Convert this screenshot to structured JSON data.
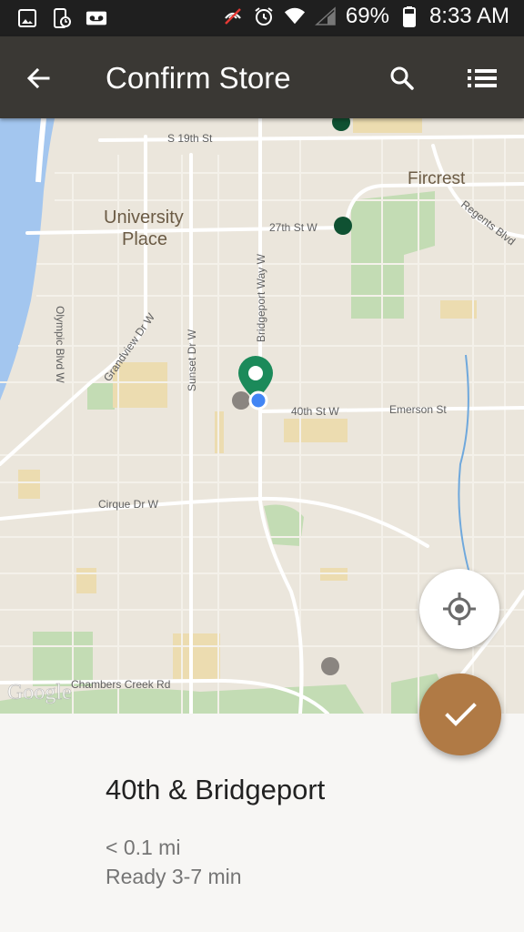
{
  "status_bar": {
    "battery_percent": "69%",
    "time": "8:33 AM",
    "left_icons": [
      "image-icon",
      "clock-phone-icon",
      "voicemail-icon"
    ],
    "right_icons": [
      "mute-icon",
      "alarm-icon",
      "wifi-icon",
      "signal-icon",
      "battery-icon"
    ]
  },
  "app_bar": {
    "title": "Confirm Store",
    "back_icon": "arrow-back-icon",
    "search_icon": "search-icon",
    "menu_icon": "list-icon",
    "background": "#3a3834"
  },
  "map": {
    "labels": {
      "s19th": "S 19th St",
      "fircrest": "Fircrest",
      "university": "University",
      "place": "Place",
      "st27": "27th St W",
      "regents": "Regents Blvd",
      "olympic": "Olympic Blvd W",
      "grandview": "Grandview Dr W",
      "sunset": "Sunset Dr W",
      "bridgeport": "Bridgeport Way W",
      "st40": "40th St W",
      "emerson": "Emerson St",
      "cirque": "Cirque Dr W",
      "chambers": "Chambers Creek Rd",
      "google": "Google"
    },
    "colors": {
      "land": "#ebe6dc",
      "water": "#a3c6ef",
      "park": "#c3dcb4",
      "road": "#ffffff",
      "selected_pin": "#1b8a5a",
      "store_dot": "#0f5132",
      "inactive_dot": "#8a8580",
      "user_dot": "#4285f4"
    }
  },
  "fab": {
    "locate_icon": "my-location-icon",
    "confirm_icon": "check-icon",
    "confirm_color": "#b07a45"
  },
  "store": {
    "name": "40th & Bridgeport",
    "distance": "< 0.1 mi",
    "ready_time": "Ready 3-7 min"
  }
}
